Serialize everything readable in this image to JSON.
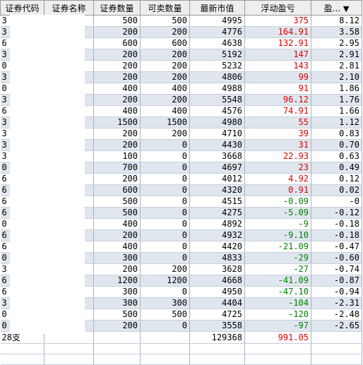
{
  "headers": {
    "code": "证券代码",
    "name": "证券名称",
    "qty": "证券数量",
    "sellable": "可卖数量",
    "mktval": "最新市值",
    "pnl": "浮动盈亏",
    "pnlpct": "盈...",
    "sort_icon": "▼"
  },
  "colors": {
    "profit": "#e00000",
    "loss": "#008000",
    "header_bg": "#eeeeee",
    "row_alt": "#dfe6ee"
  },
  "rows": [
    {
      "code": "3",
      "name": "",
      "qty": "500",
      "sellable": "500",
      "mktval": "4995",
      "pnl": "375",
      "pct": "8.12"
    },
    {
      "code": "3",
      "name": "",
      "qty": "200",
      "sellable": "200",
      "mktval": "4776",
      "pnl": "164.91",
      "pct": "3.58"
    },
    {
      "code": "6",
      "name": "",
      "qty": "600",
      "sellable": "600",
      "mktval": "4638",
      "pnl": "132.91",
      "pct": "2.95"
    },
    {
      "code": "3",
      "name": "",
      "qty": "200",
      "sellable": "200",
      "mktval": "5192",
      "pnl": "147",
      "pct": "2.91"
    },
    {
      "code": "0",
      "name": "",
      "qty": "200",
      "sellable": "200",
      "mktval": "5232",
      "pnl": "143",
      "pct": "2.81"
    },
    {
      "code": "3",
      "name": "",
      "qty": "200",
      "sellable": "200",
      "mktval": "4806",
      "pnl": "99",
      "pct": "2.10"
    },
    {
      "code": "0",
      "name": "",
      "qty": "400",
      "sellable": "400",
      "mktval": "4988",
      "pnl": "91",
      "pct": "1.86"
    },
    {
      "code": "3",
      "name": "",
      "qty": "200",
      "sellable": "200",
      "mktval": "5548",
      "pnl": "96.12",
      "pct": "1.76"
    },
    {
      "code": "6",
      "name": "",
      "qty": "400",
      "sellable": "400",
      "mktval": "4576",
      "pnl": "74.91",
      "pct": "1.66"
    },
    {
      "code": "3",
      "name": "",
      "qty": "1500",
      "sellable": "1500",
      "mktval": "4980",
      "pnl": "55",
      "pct": "1.12"
    },
    {
      "code": "3",
      "name": "",
      "qty": "200",
      "sellable": "200",
      "mktval": "4710",
      "pnl": "39",
      "pct": "0.83"
    },
    {
      "code": "3",
      "name": "",
      "qty": "200",
      "sellable": "0",
      "mktval": "4430",
      "pnl": "31",
      "pct": "0.70"
    },
    {
      "code": "3",
      "name": "",
      "qty": "100",
      "sellable": "0",
      "mktval": "3668",
      "pnl": "22.93",
      "pct": "0.63"
    },
    {
      "code": "0",
      "name": "",
      "qty": "700",
      "sellable": "0",
      "mktval": "4697",
      "pnl": "23",
      "pct": "0.49"
    },
    {
      "code": "6",
      "name": "",
      "qty": "200",
      "sellable": "0",
      "mktval": "4012",
      "pnl": "4.92",
      "pct": "0.12"
    },
    {
      "code": "6",
      "name": "",
      "qty": "600",
      "sellable": "0",
      "mktval": "4320",
      "pnl": "0.91",
      "pct": "0.02"
    },
    {
      "code": "6",
      "name": "",
      "qty": "500",
      "sellable": "0",
      "mktval": "4515",
      "pnl": "-0.09",
      "pct": "-0"
    },
    {
      "code": "6",
      "name": "",
      "qty": "500",
      "sellable": "0",
      "mktval": "4275",
      "pnl": "-5.09",
      "pct": "-0.12"
    },
    {
      "code": "0",
      "name": "",
      "qty": "400",
      "sellable": "0",
      "mktval": "4892",
      "pnl": "-9",
      "pct": "-0.18"
    },
    {
      "code": "6",
      "name": "",
      "qty": "200",
      "sellable": "0",
      "mktval": "4932",
      "pnl": "-9.10",
      "pct": "-0.18"
    },
    {
      "code": "6",
      "name": "",
      "qty": "400",
      "sellable": "0",
      "mktval": "4420",
      "pnl": "-21.09",
      "pct": "-0.47"
    },
    {
      "code": "0",
      "name": "",
      "qty": "300",
      "sellable": "0",
      "mktval": "4833",
      "pnl": "-29",
      "pct": "-0.60"
    },
    {
      "code": "3",
      "name": "",
      "qty": "200",
      "sellable": "200",
      "mktval": "3628",
      "pnl": "-27",
      "pct": "-0.74"
    },
    {
      "code": "6",
      "name": "",
      "qty": "1200",
      "sellable": "1200",
      "mktval": "4668",
      "pnl": "-41.09",
      "pct": "-0.87"
    },
    {
      "code": "6",
      "name": "",
      "qty": "300",
      "sellable": "0",
      "mktval": "4950",
      "pnl": "-47.10",
      "pct": "-0.94"
    },
    {
      "code": "3",
      "name": "",
      "qty": "300",
      "sellable": "300",
      "mktval": "4404",
      "pnl": "-104",
      "pct": "-2.31"
    },
    {
      "code": "0",
      "name": "",
      "qty": "500",
      "sellable": "500",
      "mktval": "4725",
      "pnl": "-120",
      "pct": "-2.48"
    },
    {
      "code": "0",
      "name": "",
      "qty": "200",
      "sellable": "0",
      "mktval": "3558",
      "pnl": "-97",
      "pct": "-2.65"
    }
  ],
  "total": {
    "count": "28支",
    "mktval": "129368",
    "pnl": "991.05"
  }
}
